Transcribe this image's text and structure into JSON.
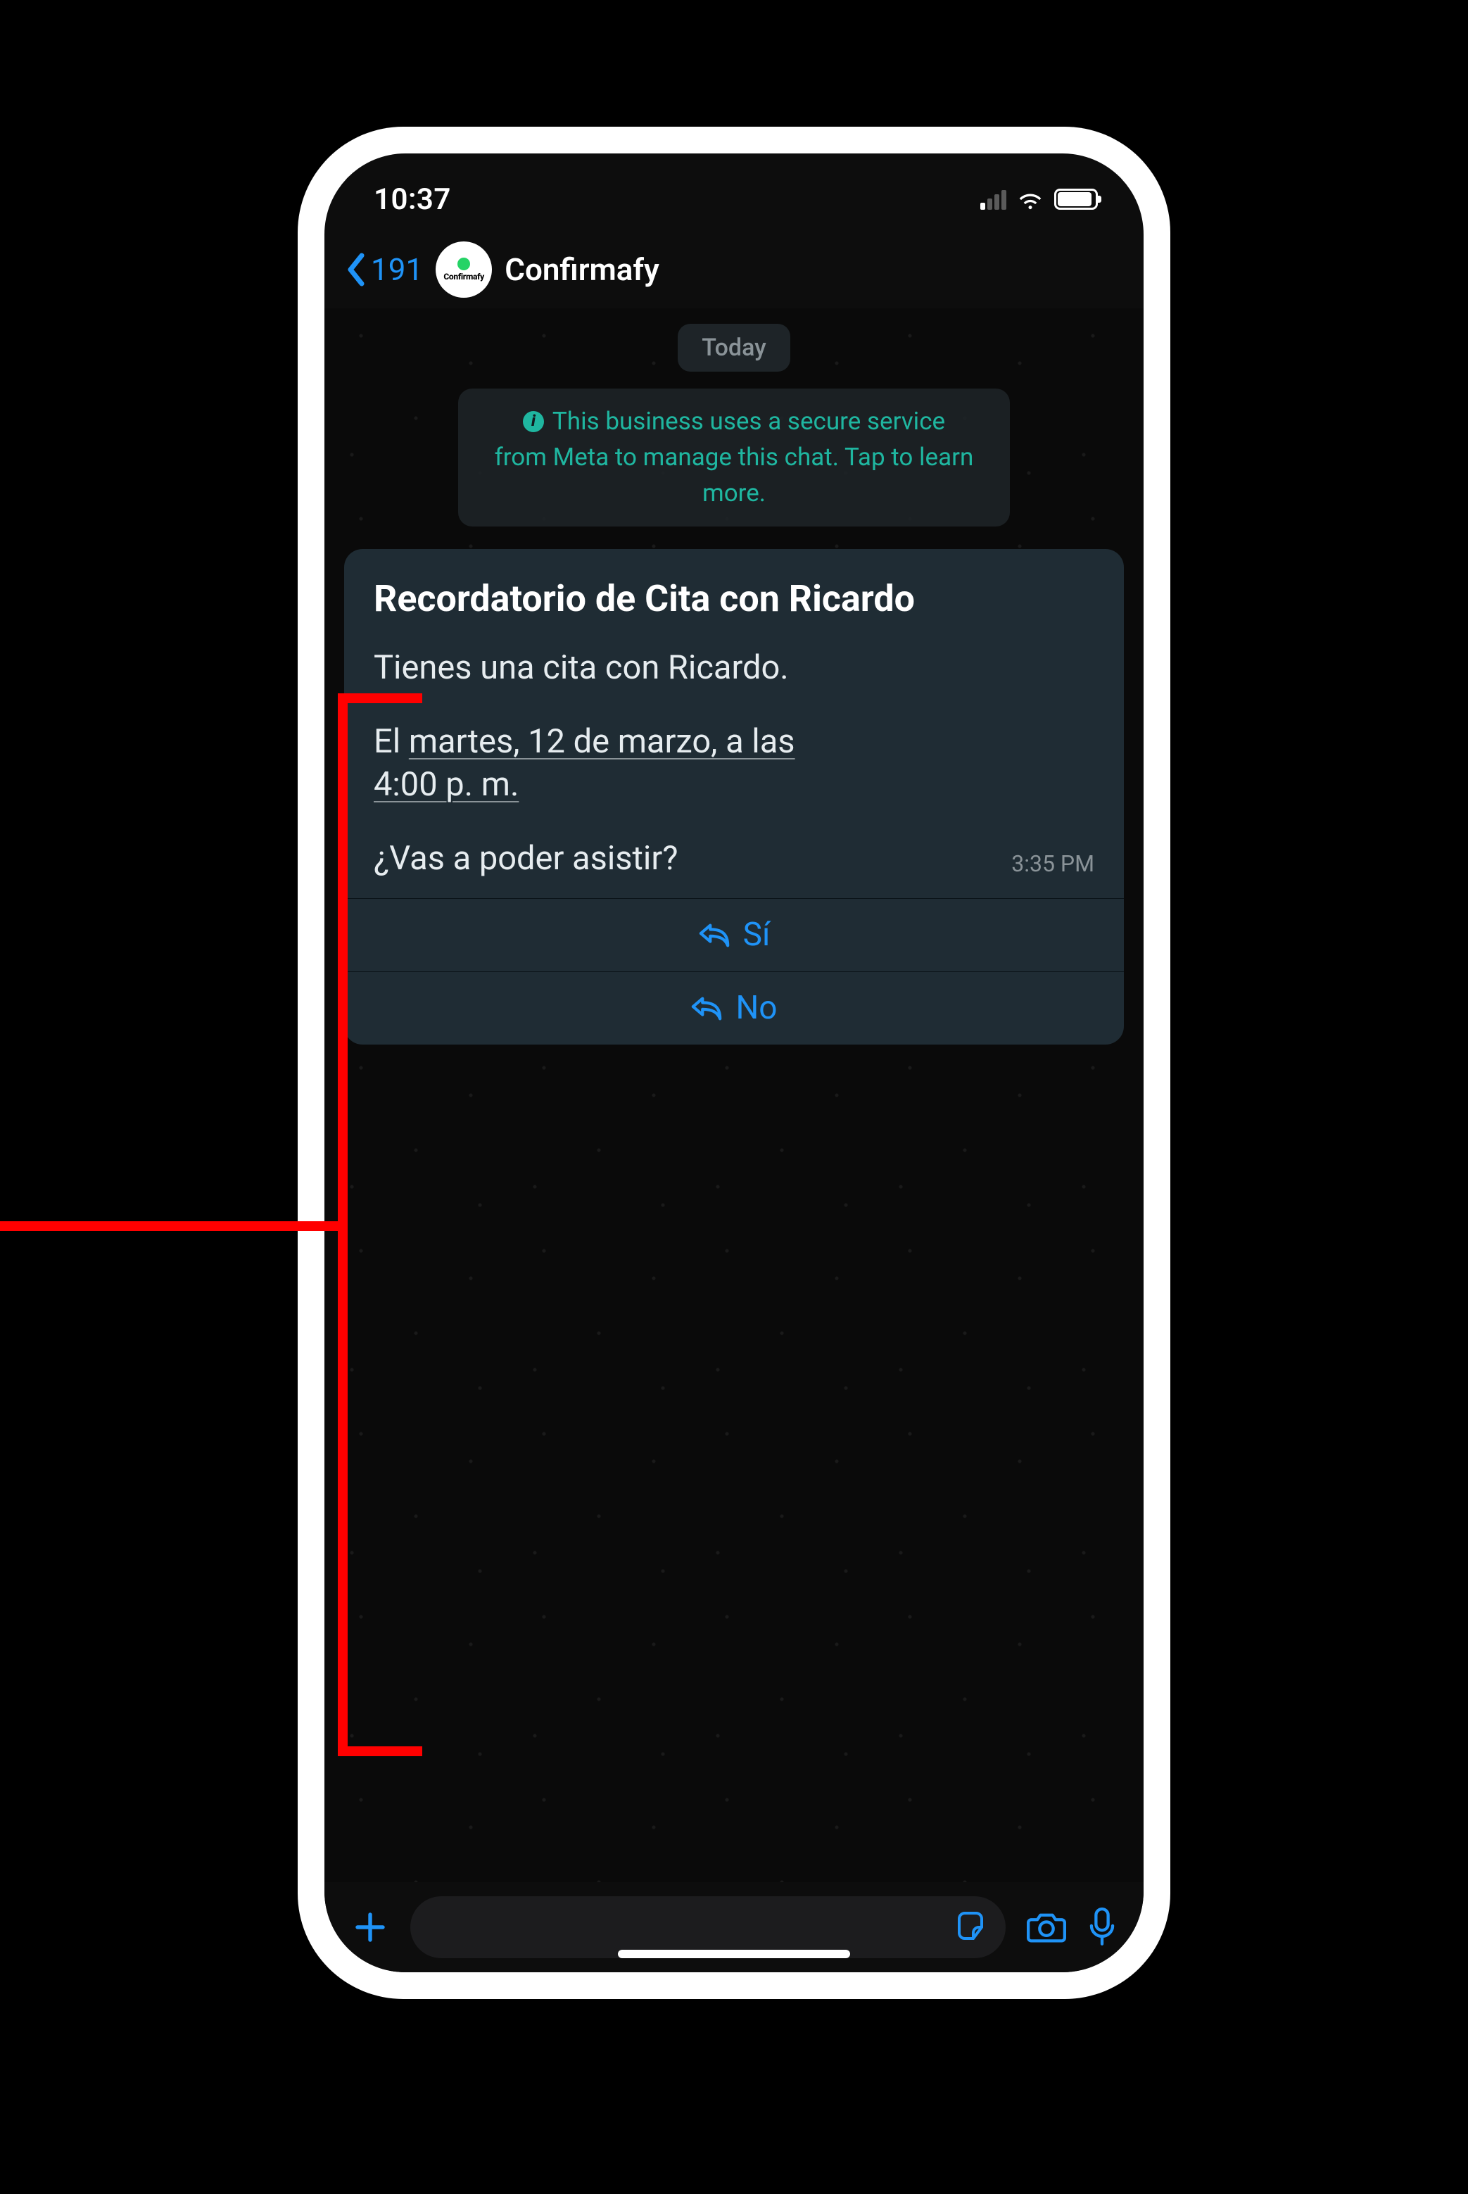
{
  "status": {
    "time": "10:37"
  },
  "header": {
    "back_count": "191",
    "avatar_label": "Confirmafy",
    "contact_name": "Confirmafy"
  },
  "chat": {
    "date_label": "Today",
    "security_notice_line1": "This business uses a secure service",
    "security_notice_line2": "from Meta to manage this chat. Tap to learn",
    "security_notice_line3": "more."
  },
  "message": {
    "title": "Recordatorio de Cita con Ricardo",
    "line1": "Tienes una cita con Ricardo.",
    "datetime_part1": "El ",
    "datetime_underlined1": "martes, 12 de marzo, a las",
    "datetime_underlined2": "4:00 p. m.",
    "question": "¿Vas a poder asistir?",
    "timestamp": "3:35 PM",
    "reply_yes": "Sí",
    "reply_no": "No"
  }
}
